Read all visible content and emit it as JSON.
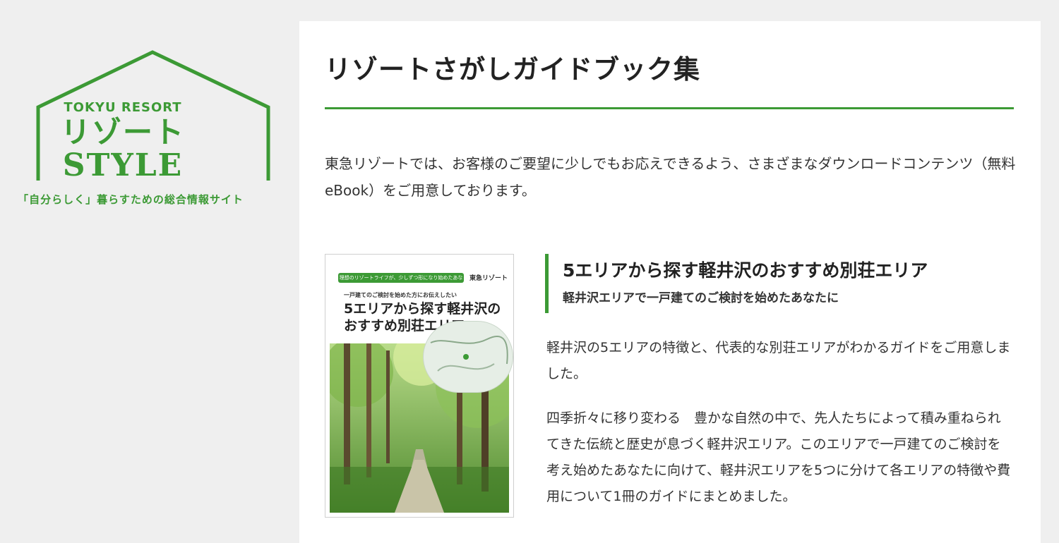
{
  "logo": {
    "brand_en": "TOKYU RESORT",
    "brand_ja": "リゾート",
    "brand_style": "STYLE",
    "tagline": "「自分らしく」暮らすための総合情報サイト",
    "color": "#3c9a35"
  },
  "page": {
    "title": "リゾートさがしガイドブック集",
    "intro": "東急リゾートでは、お客様のご要望に少しでもお応えできるよう、さまざまなダウンロードコンテンツ（無料eBook）をご用意しております。"
  },
  "book": {
    "cover": {
      "banner": "理想のリゾートライフが、少しずつ形になり始めたあなたへ",
      "brand": "東急リゾート",
      "subtitle": "一戸建てのご検討を始めた方にお伝えしたい",
      "title_line1": "5エリアから探す軽井沢の",
      "title_line2": "おすすめ別荘エリア"
    },
    "title": "5エリアから探す軽井沢のおすすめ別荘エリア",
    "subtitle": "軽井沢エリアで一戸建てのご検討を始めたあなたに",
    "paragraphs": [
      "軽井沢の5エリアの特徴と、代表的な別荘エリアがわかるガイドをご用意しました。",
      "四季折々に移り変わる　豊かな自然の中で、先人たちによって積み重ねられてきた伝統と歴史が息づく軽井沢エリア。このエリアで一戸建てのご検討を考え始めたあなたに向けて、軽井沢エリアを5つに分けて各エリアの特徴や費用について1冊のガイドにまとめました。"
    ]
  },
  "colors": {
    "accent": "#3c9a35",
    "panel": "#ffffff",
    "background": "#efefef"
  }
}
